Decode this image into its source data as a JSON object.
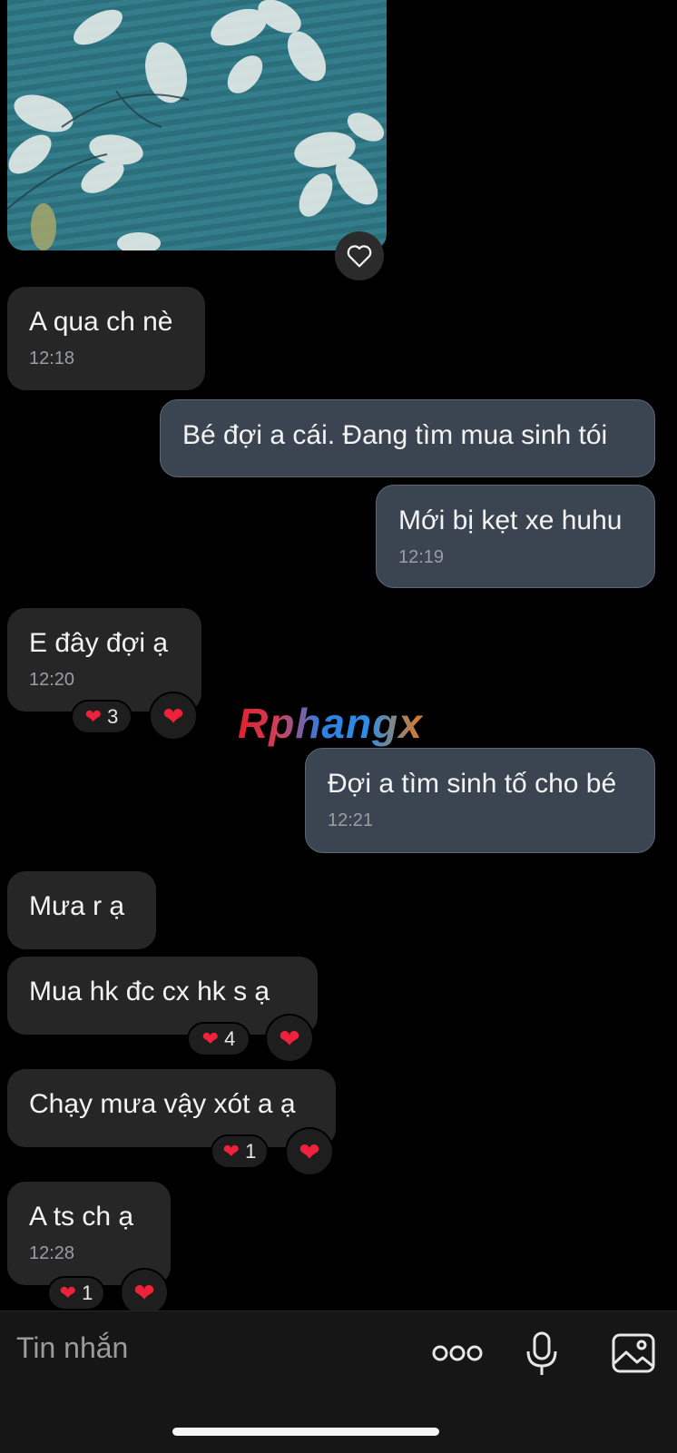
{
  "messages": [
    {
      "id": "m1",
      "dir": "in",
      "text": "A qua ch nè",
      "time": "12:18"
    },
    {
      "id": "m2",
      "dir": "out",
      "text": "Bé đợi a cái. Đang tìm mua sinh tói"
    },
    {
      "id": "m3",
      "dir": "out",
      "text": "Mới bị kẹt xe huhu",
      "time": "12:19"
    },
    {
      "id": "m4",
      "dir": "in",
      "text": "E đây đợi ạ",
      "time": "12:20",
      "reaction_count": "3"
    },
    {
      "id": "m5",
      "dir": "out",
      "text": "Đợi a tìm sinh tố cho bé",
      "time": "12:21"
    },
    {
      "id": "m6",
      "dir": "in",
      "text": "Mưa r ạ"
    },
    {
      "id": "m7",
      "dir": "in",
      "text": "Mua hk đc cx hk s ạ",
      "reaction_count": "4"
    },
    {
      "id": "m8",
      "dir": "in",
      "text": "Chạy mưa vậy xót a ạ",
      "reaction_count": "1"
    },
    {
      "id": "m9",
      "dir": "in",
      "text": "A ts ch ạ",
      "time": "12:28",
      "reaction_count": "1"
    }
  ],
  "watermark": "Rphangx",
  "composer": {
    "placeholder": "Tin nhắn",
    "icons": [
      "more-dots-icon",
      "microphone-icon",
      "image-gallery-icon"
    ]
  },
  "colors": {
    "background": "#000000",
    "incoming_bubble": "#262626",
    "outgoing_bubble": "#3a4551",
    "reaction_heart": "#f0213a"
  }
}
